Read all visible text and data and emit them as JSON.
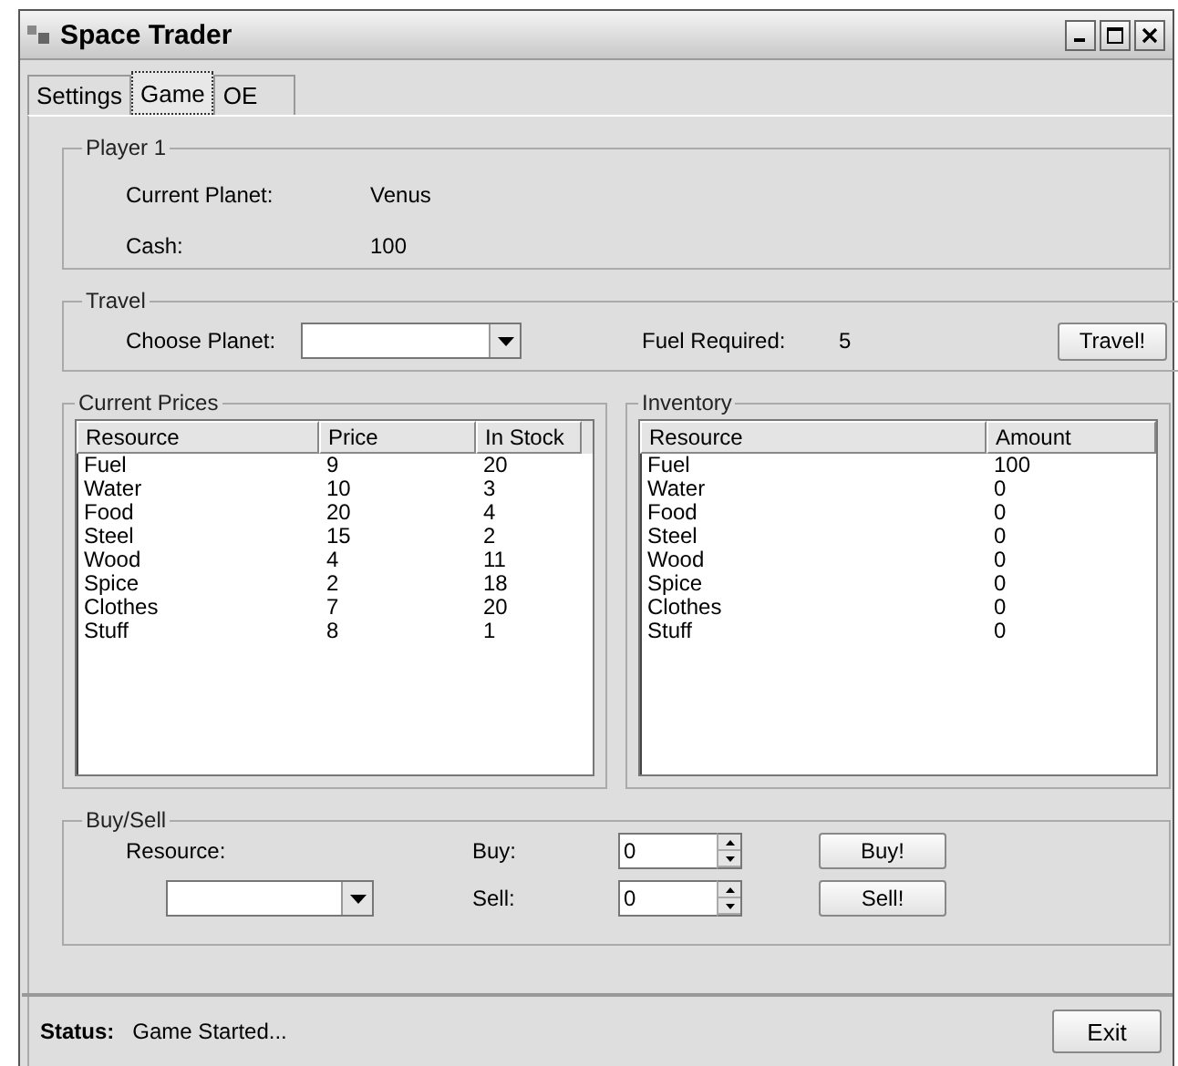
{
  "window": {
    "title": "Space Trader"
  },
  "tabs": [
    {
      "label": "Settings",
      "selected": false
    },
    {
      "label": "Game",
      "selected": true
    },
    {
      "label": "OE",
      "selected": false
    }
  ],
  "player": {
    "title": "Player 1",
    "rows": [
      {
        "label": "Current Planet:",
        "value": "Venus"
      },
      {
        "label": "Cash:",
        "value": "100"
      }
    ]
  },
  "travel": {
    "title": "Travel",
    "planet_label": "Choose Planet:",
    "fuel_label": "Fuel Required:",
    "fuel_value": "5",
    "button": "Travel!"
  },
  "prices": {
    "title": "Current Prices",
    "columns": [
      "Resource",
      "Price",
      "In Stock"
    ],
    "rows": [
      [
        "Fuel",
        "9",
        "20"
      ],
      [
        "Water",
        "10",
        "3"
      ],
      [
        "Food",
        "20",
        "4"
      ],
      [
        "Steel",
        "15",
        "2"
      ],
      [
        "Wood",
        "4",
        "11"
      ],
      [
        "Spice",
        "2",
        "18"
      ],
      [
        "Clothes",
        "7",
        "20"
      ],
      [
        "Stuff",
        "8",
        "1"
      ]
    ]
  },
  "inventory": {
    "title": "Inventory",
    "columns": [
      "Resource",
      "Amount"
    ],
    "rows": [
      [
        "Fuel",
        "100"
      ],
      [
        "Water",
        "0"
      ],
      [
        "Food",
        "0"
      ],
      [
        "Steel",
        "0"
      ],
      [
        "Wood",
        "0"
      ],
      [
        "Spice",
        "0"
      ],
      [
        "Clothes",
        "0"
      ],
      [
        "Stuff",
        "0"
      ]
    ]
  },
  "buy_sell": {
    "title": "Buy/Sell",
    "resource_label": "Resource:",
    "buy_label": "Buy:",
    "buy_value": "0",
    "sell_label": "Sell:",
    "sell_value": "0",
    "buy_button": "Buy!",
    "sell_button": "Sell!"
  },
  "status_bar": {
    "label": "Status:",
    "text": "Game Started..."
  },
  "exit_button": "Exit"
}
